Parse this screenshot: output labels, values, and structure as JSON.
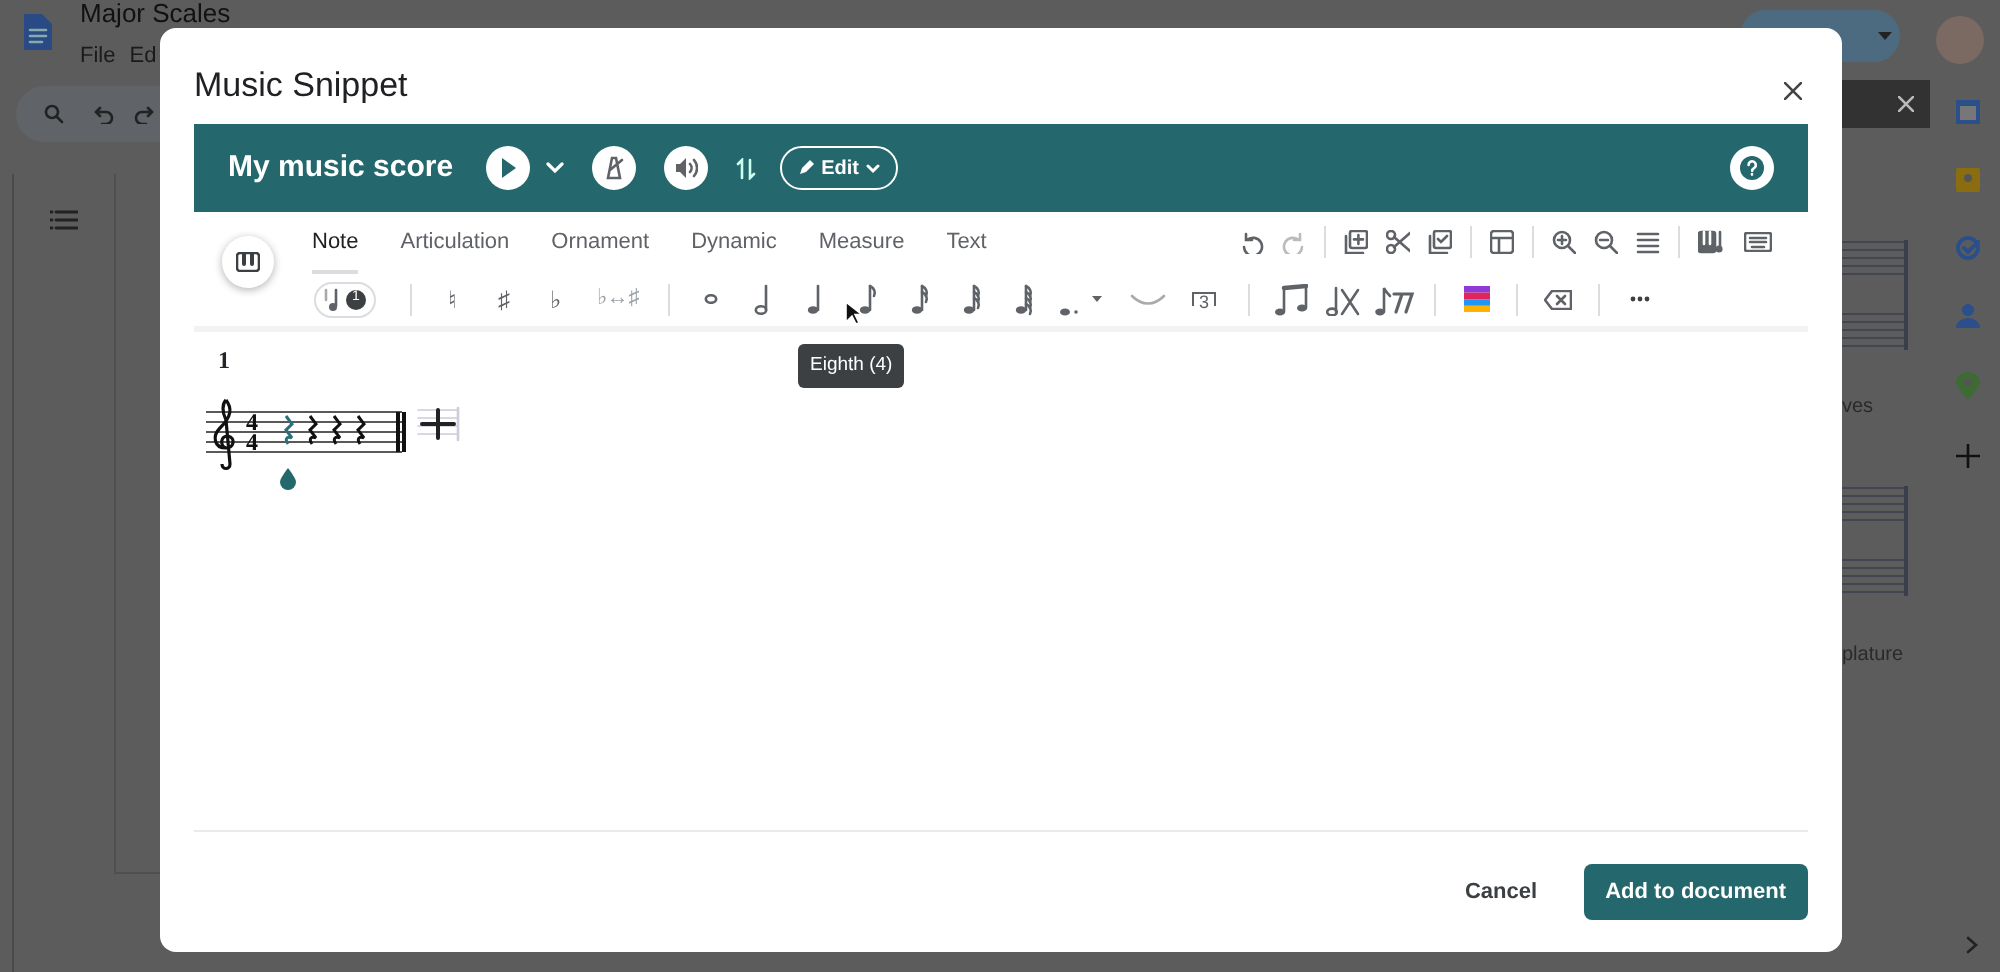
{
  "background": {
    "doc_title": "Major Scales",
    "menu": [
      "File",
      "Ed"
    ],
    "side_texts": [
      "ves",
      "plature"
    ]
  },
  "dialog": {
    "title": "Music Snippet"
  },
  "score_header": {
    "title": "My music score",
    "edit_label": "Edit"
  },
  "tabs": [
    {
      "label": "Note",
      "selected": true
    },
    {
      "label": "Articulation",
      "selected": false
    },
    {
      "label": "Ornament",
      "selected": false
    },
    {
      "label": "Dynamic",
      "selected": false
    },
    {
      "label": "Measure",
      "selected": false
    },
    {
      "label": "Text",
      "selected": false
    }
  ],
  "note_toolbar": {
    "voice_badge": "1",
    "accidentals": [
      "♮",
      "♯",
      "♭",
      "♭↔♯"
    ],
    "tuplet": "3"
  },
  "tooltip": "Eighth (4)",
  "score": {
    "measure_number": "1",
    "time_signature": [
      "4",
      "4"
    ],
    "rests": [
      {
        "selected": true
      },
      {
        "selected": false
      },
      {
        "selected": false
      },
      {
        "selected": false
      }
    ]
  },
  "buttons": {
    "cancel": "Cancel",
    "add": "Add to document"
  }
}
